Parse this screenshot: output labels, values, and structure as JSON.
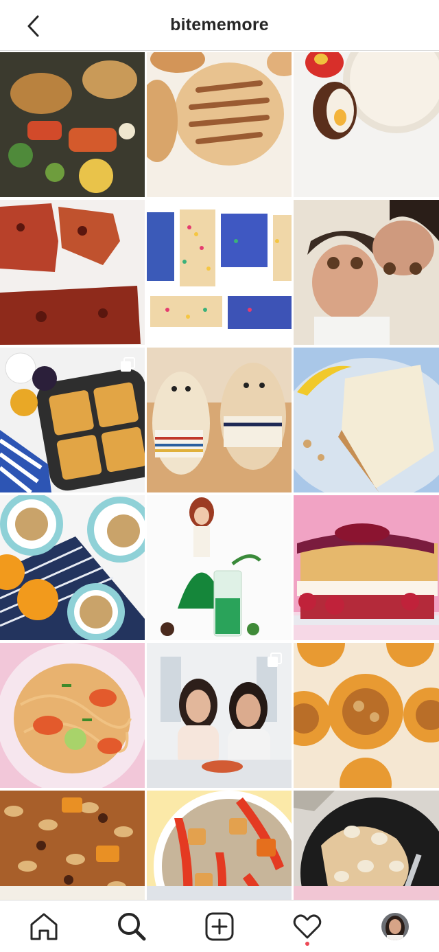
{
  "header": {
    "title": "bitememore",
    "back_icon": "chevron-left-icon"
  },
  "grid": {
    "tiles": [
      {
        "name": "post-roasted-chicken-vegetables",
        "multi": false
      },
      {
        "name": "post-grilled-burger-buns",
        "multi": false
      },
      {
        "name": "post-chocolate-eggs-drink",
        "multi": false
      },
      {
        "name": "post-glazed-salmon",
        "multi": false
      },
      {
        "name": "post-sprinkle-matzo",
        "multi": false
      },
      {
        "name": "post-women-with-truffles",
        "multi": false
      },
      {
        "name": "post-waffle-maker",
        "multi": true
      },
      {
        "name": "post-golden-retrievers",
        "multi": false
      },
      {
        "name": "post-banana-cake",
        "multi": false
      },
      {
        "name": "post-cookies-orange",
        "multi": false
      },
      {
        "name": "post-doll-green-drink",
        "multi": false
      },
      {
        "name": "post-berry-shortcake",
        "multi": false
      },
      {
        "name": "post-shrimp-noodles",
        "multi": false
      },
      {
        "name": "post-women-dining",
        "multi": true
      },
      {
        "name": "post-caramel-cupcakes",
        "multi": false
      },
      {
        "name": "post-granola",
        "multi": false
      },
      {
        "name": "post-pepper-tofu-rice",
        "multi": false
      },
      {
        "name": "post-chicken-mushroom-sauce",
        "multi": false
      }
    ]
  },
  "tabbar": {
    "items": [
      "home-icon",
      "search-icon",
      "new-post-icon",
      "activity-icon",
      "profile-avatar"
    ],
    "active": "search-icon",
    "notification_dot_color": "#ed4956"
  }
}
